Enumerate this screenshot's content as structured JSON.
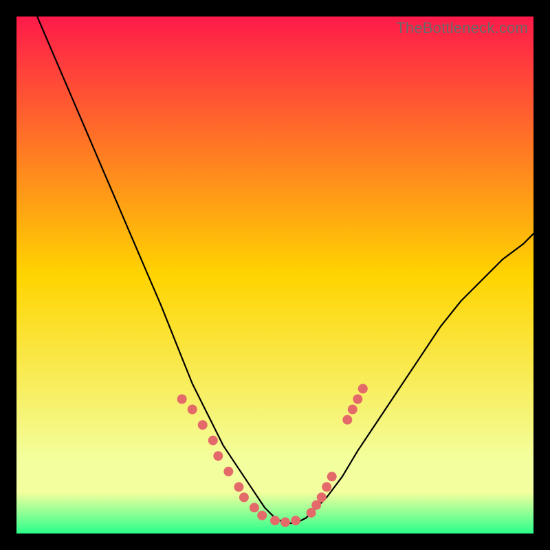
{
  "watermark": "TheBottleneck.com",
  "colors": {
    "gradient_top": "#ff1a4a",
    "gradient_mid": "#ffd400",
    "gradient_bottom_band": "#f3ff9e",
    "gradient_bottom": "#2bff8a",
    "curve": "#000000",
    "marker": "#e46a6a",
    "frame_bg": "#000000"
  },
  "chart_data": {
    "type": "line",
    "title": "",
    "xlabel": "",
    "ylabel": "",
    "xlim": [
      0,
      100
    ],
    "ylim": [
      0,
      100
    ],
    "grid": false,
    "legend": null,
    "series": [
      {
        "name": "curve",
        "x": [
          4,
          7,
          10,
          13,
          16,
          19,
          22,
          25,
          28,
          30,
          32,
          34,
          36,
          38,
          40,
          42,
          44,
          46,
          48,
          50,
          52,
          54,
          56,
          58,
          60,
          63,
          66,
          70,
          74,
          78,
          82,
          86,
          90,
          94,
          98,
          100
        ],
        "y": [
          100,
          93,
          86,
          79,
          72,
          65,
          58,
          51,
          44,
          39,
          34,
          29,
          25,
          21,
          17,
          14,
          11,
          8,
          5,
          3,
          2,
          2,
          3,
          5,
          7,
          11,
          16,
          22,
          28,
          34,
          40,
          45,
          49,
          53,
          56,
          58
        ]
      }
    ],
    "markers": [
      {
        "x": 32,
        "y": 26
      },
      {
        "x": 34,
        "y": 24
      },
      {
        "x": 36,
        "y": 21
      },
      {
        "x": 38,
        "y": 18
      },
      {
        "x": 39,
        "y": 15
      },
      {
        "x": 41,
        "y": 12
      },
      {
        "x": 43,
        "y": 9
      },
      {
        "x": 44,
        "y": 7
      },
      {
        "x": 46,
        "y": 5
      },
      {
        "x": 47.5,
        "y": 3.5
      },
      {
        "x": 50,
        "y": 2.5
      },
      {
        "x": 52,
        "y": 2.2
      },
      {
        "x": 54,
        "y": 2.5
      },
      {
        "x": 57,
        "y": 4
      },
      {
        "x": 58,
        "y": 5.5
      },
      {
        "x": 59,
        "y": 7
      },
      {
        "x": 60,
        "y": 9
      },
      {
        "x": 61,
        "y": 11
      },
      {
        "x": 64,
        "y": 22
      },
      {
        "x": 65,
        "y": 24
      },
      {
        "x": 66,
        "y": 26
      },
      {
        "x": 67,
        "y": 28
      }
    ]
  }
}
